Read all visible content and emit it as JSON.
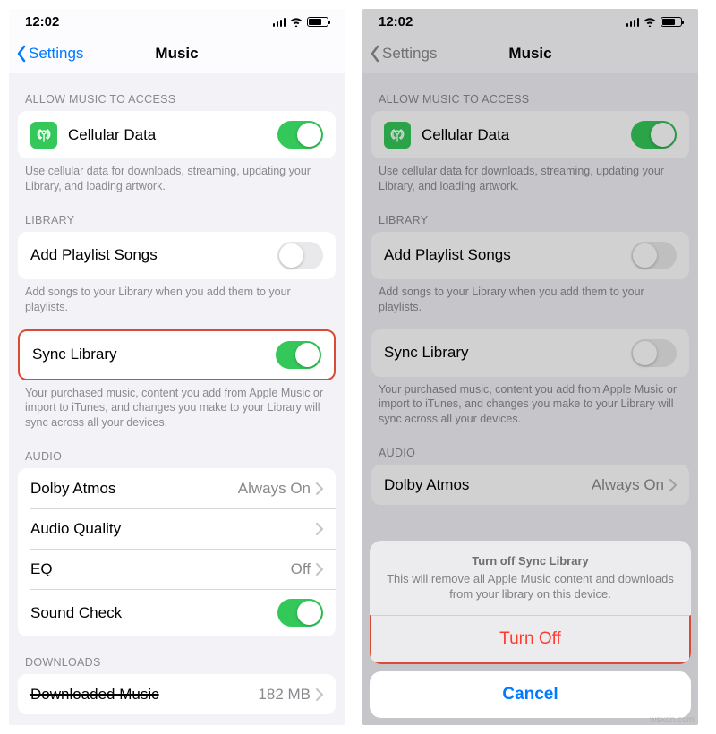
{
  "status": {
    "time": "12:02"
  },
  "nav": {
    "back": "Settings",
    "title": "Music"
  },
  "sections": {
    "access": {
      "header": "ALLOW MUSIC TO ACCESS",
      "cellular_label": "Cellular Data",
      "cellular_footer": "Use cellular data for downloads, streaming, updating your Library, and loading artwork."
    },
    "library": {
      "header": "LIBRARY",
      "add_playlist_label": "Add Playlist Songs",
      "add_playlist_footer": "Add songs to your Library when you add them to your playlists.",
      "sync_label": "Sync Library",
      "sync_footer": "Your purchased music, content you add from Apple Music or import to iTunes, and changes you make to your Library will sync across all your devices."
    },
    "audio": {
      "header": "AUDIO",
      "dolby_label": "Dolby Atmos",
      "dolby_value": "Always On",
      "audio_quality_label": "Audio Quality",
      "eq_label": "EQ",
      "eq_value": "Off",
      "sound_check_label": "Sound Check"
    },
    "downloads": {
      "header": "DOWNLOADS",
      "downloaded_label": "Downloaded Music",
      "downloaded_value": "182 MB"
    }
  },
  "sheet": {
    "title": "Turn off Sync Library",
    "message": "This will remove all Apple Music content and downloads from your library on this device.",
    "destructive": "Turn Off",
    "cancel": "Cancel"
  },
  "watermark": "wsxdn.com"
}
